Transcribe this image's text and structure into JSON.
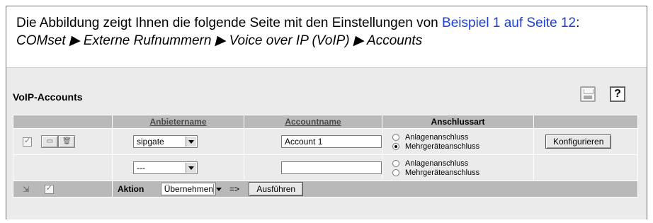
{
  "intro": {
    "text_before": "Die Abbildung zeigt Ihnen die folgende Seite mit den Einstellungen von ",
    "link": "Beispiel 1 auf Seite 12",
    "text_after": ":",
    "path": "COMset ▶ Externe Rufnummern ▶ Voice over IP (VoIP) ▶ Accounts"
  },
  "panel": {
    "title": "VoIP-Accounts",
    "help_label": "?"
  },
  "table": {
    "headers": [
      "Anbietername",
      "Accountname",
      "Anschlussart"
    ],
    "rows": [
      {
        "checked": true,
        "provider": "sipgate",
        "account": "Account 1",
        "radio_options": [
          "Anlagenanschluss",
          "Mehrgeräteanschluss"
        ],
        "selected": 1,
        "configure_label": "Konfigurieren"
      },
      {
        "checked": false,
        "provider": "---",
        "account": "",
        "radio_options": [
          "Anlagenanschluss",
          "Mehrgeräteanschluss"
        ],
        "selected": null
      }
    ],
    "footer": {
      "action_label": "Aktion",
      "action_value": "Übernehmen",
      "arrow": "=>",
      "execute_label": "Ausführen"
    }
  }
}
